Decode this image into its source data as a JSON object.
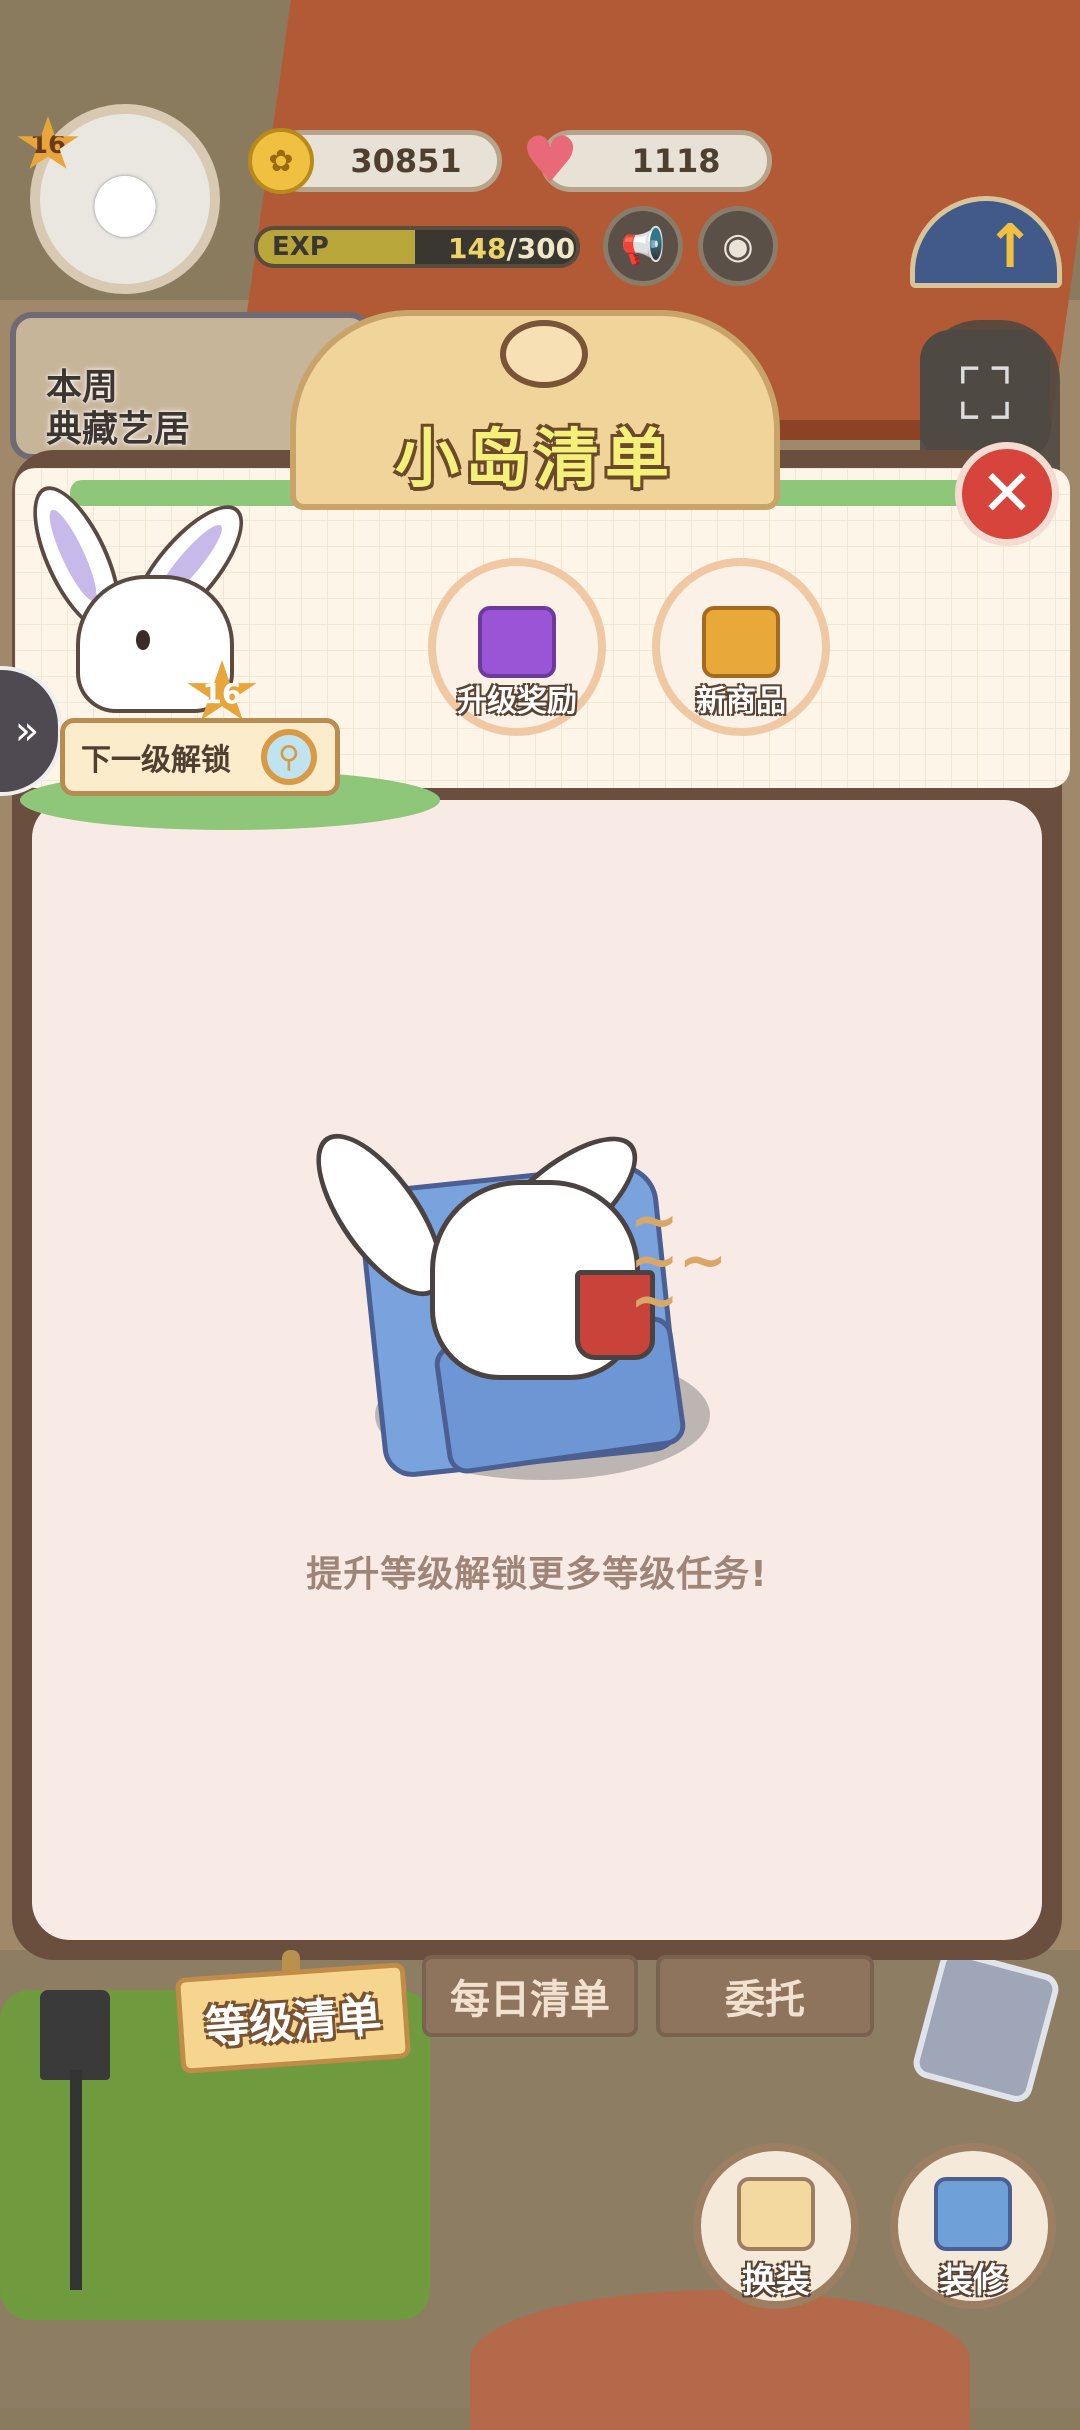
{
  "hud": {
    "level": "16",
    "coins": "30851",
    "hearts": "1118",
    "exp_label": "EXP",
    "exp_current": "148",
    "exp_separator": "/",
    "exp_max": "300",
    "exp_progress": 0.493,
    "weekly_line1": "本周",
    "weekly_line2": "典藏艺居"
  },
  "panel": {
    "title": "小岛清单",
    "mascot_level": "16",
    "next_unlock_label": "下一级解锁",
    "rewards": [
      {
        "label": "升级奖励",
        "icon": "gift-box-icon"
      },
      {
        "label": "新商品",
        "icon": "bag-icon"
      }
    ],
    "empty_message": "提升等级解锁更多等级任务!"
  },
  "tabs": [
    {
      "label": "等级清单",
      "active": true
    },
    {
      "label": "每日清单",
      "active": false
    },
    {
      "label": "委托",
      "active": false
    }
  ],
  "actions": [
    {
      "label": "换装",
      "icon": "outfit-icon"
    },
    {
      "label": "装修",
      "icon": "decorate-icon"
    }
  ],
  "colors": {
    "close_red": "#d7443c",
    "title_yellow": "#f4f07a",
    "panel_brown": "#6a4f3f",
    "panel_bg": "#f8ebe6",
    "exp_fill": "#b9a63a"
  }
}
